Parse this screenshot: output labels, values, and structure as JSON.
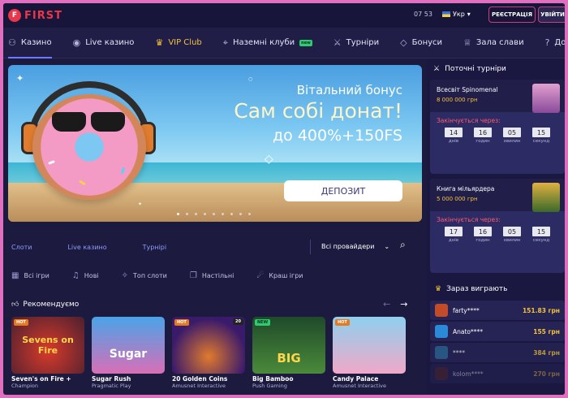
{
  "header": {
    "logo_mark": "F",
    "logo_text": "FIRST",
    "time": "07 53",
    "language": "Укр",
    "register_label": "РЕЄСТРАЦІЯ",
    "login_label": "УВІЙТИ"
  },
  "nav": {
    "items": [
      {
        "label": "Казино",
        "icon": "bike-icon"
      },
      {
        "label": "Live казино",
        "icon": "live-icon"
      },
      {
        "label": "VIP Club",
        "icon": "crown-icon"
      },
      {
        "label": "Наземні клуби",
        "icon": "location-icon",
        "badge": "new"
      },
      {
        "label": "Турніри",
        "icon": "swords-icon"
      },
      {
        "label": "Бонуси",
        "icon": "diamond-icon"
      },
      {
        "label": "Зала слави",
        "icon": "trophy-icon"
      },
      {
        "label": "Довідка",
        "icon": "help-icon"
      }
    ]
  },
  "banner": {
    "subtitle": "Вітальний бонус",
    "title": "Сам собі донат!",
    "line": "до 400%+150FS",
    "button": "ДЕПОЗИТ",
    "slide_count": 9
  },
  "tabs": {
    "items": [
      "Слоти",
      "Live казино",
      "Турнірі"
    ],
    "providers": "Всі провайдери"
  },
  "categories": {
    "items": [
      {
        "label": "Всі ігри",
        "icon": "grid-icon"
      },
      {
        "label": "Нові",
        "icon": "bell-icon"
      },
      {
        "label": "Топ слоти",
        "icon": "fire-icon"
      },
      {
        "label": "Настільні",
        "icon": "cards-icon"
      },
      {
        "label": "Краш ігри",
        "icon": "crash-icon"
      }
    ]
  },
  "recommended": {
    "title": "Рекомендуємо",
    "games": [
      {
        "name": "Seven's on Fire +",
        "provider": "Champion",
        "tag": "HOT",
        "thumb_text": "Sevens on Fire",
        "color": "#4a2030"
      },
      {
        "name": "Sugar Rush",
        "provider": "Pragmatic Play",
        "tag": "",
        "thumb_text": "Sugar",
        "color": "#3a6fd8"
      },
      {
        "name": "20 Golden Coins",
        "provider": "Amusnet Interactive",
        "tag": "HOT",
        "tag2": "20",
        "thumb_text": "",
        "color": "#3a1a6b"
      },
      {
        "name": "Big Bamboo",
        "provider": "Push Gaming",
        "tag": "NEW",
        "thumb_text": "BIG",
        "color": "#2f6a3c"
      },
      {
        "name": "Candy Palace",
        "provider": "Amusnet Interactive",
        "tag": "HOT",
        "thumb_text": "",
        "color": "#6fb6d8"
      }
    ]
  },
  "sidebar": {
    "tournaments_title": "Поточні турніри",
    "tournaments": [
      {
        "name": "Всесвіт Spinomenal",
        "prize": "8 000 000 грн",
        "ends_label": "Закінчується через:",
        "d": "14",
        "h": "16",
        "m": "05",
        "s": "15",
        "color": "#b86fb0"
      },
      {
        "name": "Книга мільярдера",
        "prize": "5 000 000 грн",
        "ends_label": "Закінчується через:",
        "d": "17",
        "h": "16",
        "m": "05",
        "s": "15",
        "color": "#3a6a2a"
      }
    ],
    "units": {
      "d": "днів",
      "h": "годин",
      "m": "хвилин",
      "s": "секунд"
    },
    "winners_title": "Зараз виграють",
    "winners": [
      {
        "name": "farty****",
        "amount": "151.83 грн",
        "color": "#c24b2a"
      },
      {
        "name": "Anato****",
        "amount": "155 грн",
        "color": "#2a8ad8"
      },
      {
        "name": "****",
        "amount": "384 грн",
        "color": "#2e6a9a"
      },
      {
        "name": "kolom****",
        "amount": "270 грн",
        "color": "#5a2a2a"
      }
    ]
  }
}
